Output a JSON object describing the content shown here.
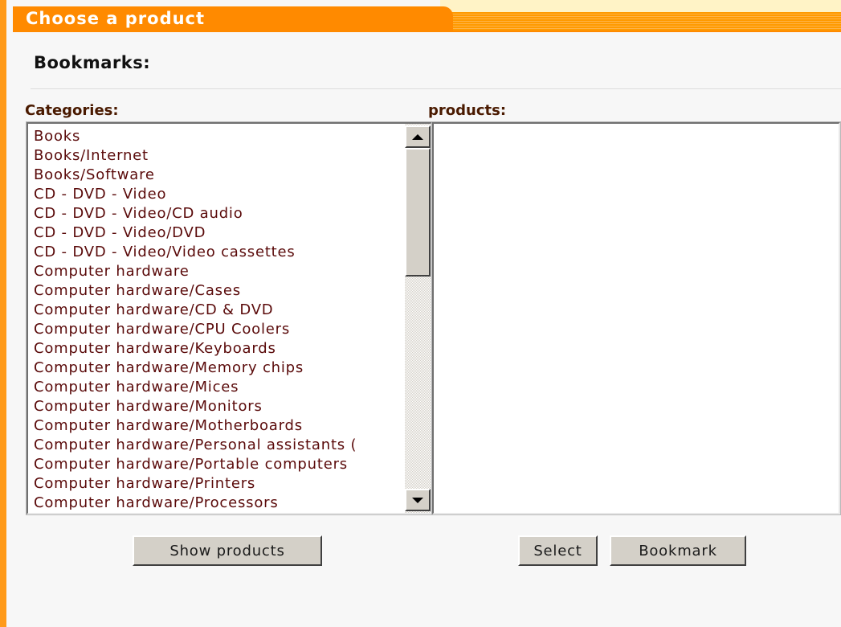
{
  "window": {
    "title": "Choose a product"
  },
  "section": {
    "heading": "Bookmarks:"
  },
  "categories": {
    "label": "Categories:",
    "items": [
      "Books",
      "Books/Internet",
      "Books/Software",
      "CD - DVD - Video",
      "CD - DVD - Video/CD audio",
      "CD - DVD - Video/DVD",
      "CD - DVD - Video/Video cassettes",
      "Computer hardware",
      "Computer hardware/Cases",
      "Computer hardware/CD & DVD",
      "Computer hardware/CPU Coolers",
      "Computer hardware/Keyboards",
      "Computer hardware/Memory chips",
      "Computer hardware/Mices",
      "Computer hardware/Monitors",
      "Computer hardware/Motherboards",
      "Computer hardware/Personal assistants (",
      "Computer hardware/Portable computers",
      "Computer hardware/Printers",
      "Computer hardware/Processors"
    ]
  },
  "products": {
    "label": "products:",
    "items": []
  },
  "buttons": {
    "show_products": "Show products",
    "select": "Select",
    "bookmark": "Bookmark"
  },
  "colors": {
    "accent": "#ff8a00",
    "category_text": "#5a0a0a",
    "label_text": "#4a1a00"
  },
  "icons": {
    "scroll_up": "scroll-up-arrow-icon",
    "scroll_down": "scroll-down-arrow-icon"
  }
}
